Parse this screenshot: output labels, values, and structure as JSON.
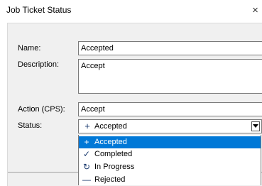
{
  "window": {
    "title": "Job Ticket Status",
    "close_glyph": "×"
  },
  "form": {
    "name_label": "Name:",
    "name_value": "Accepted",
    "description_label": "Description:",
    "description_value": "Accept",
    "action_label": "Action (CPS):",
    "action_value": "Accept",
    "status_label": "Status:",
    "status_value": "Accepted",
    "status_icon": "+",
    "status_icon_name": "plus-icon"
  },
  "status_options": [
    {
      "label": "Accepted",
      "icon": "+",
      "icon_name": "plus-icon",
      "selected": true
    },
    {
      "label": "Completed",
      "icon": "✓",
      "icon_name": "checkmark-icon",
      "selected": false
    },
    {
      "label": "In Progress",
      "icon": "↻",
      "icon_name": "refresh-icon",
      "selected": false
    },
    {
      "label": "Rejected",
      "icon": "—",
      "icon_name": "minus-icon",
      "selected": false
    }
  ],
  "colors": {
    "selection": "#0078d7",
    "dialog_bg": "#f0f0f0"
  }
}
